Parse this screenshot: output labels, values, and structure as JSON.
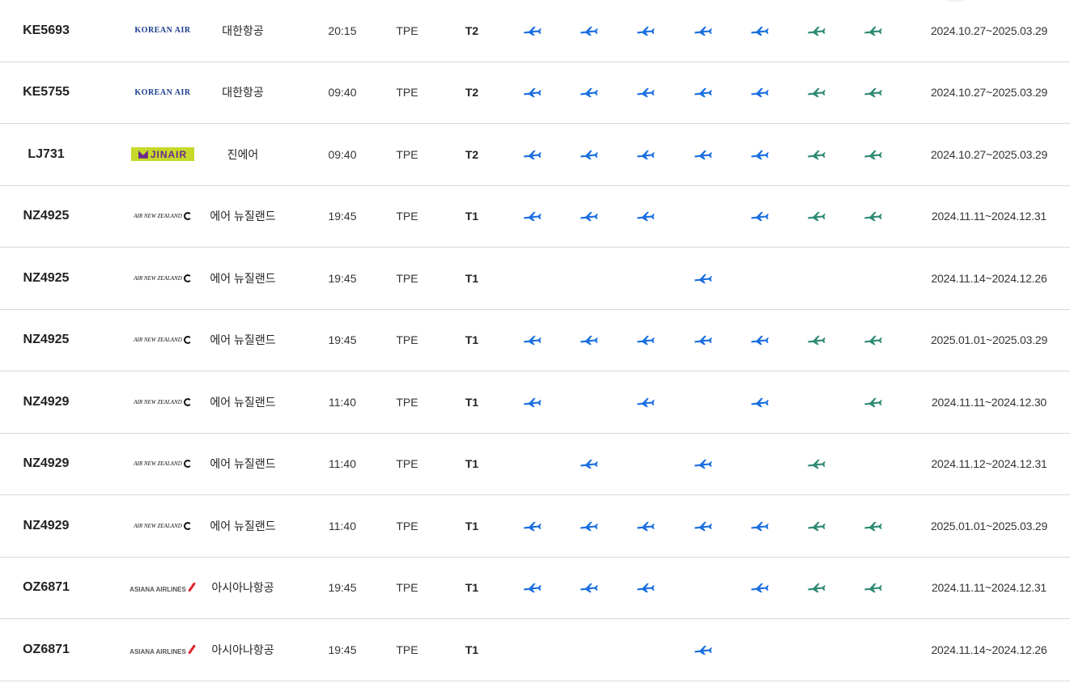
{
  "schedule": {
    "rows": [
      {
        "flight": "KE5693",
        "logo": "korean-air",
        "logo_text": "KOREAN AIR",
        "airline": "대한항공",
        "time": "20:15",
        "dest": "TPE",
        "terminal": "T2",
        "days": [
          "blue",
          "blue",
          "blue",
          "blue",
          "blue",
          "green",
          "green"
        ],
        "period": "2024.10.27~2025.03.29"
      },
      {
        "flight": "KE5755",
        "logo": "korean-air",
        "logo_text": "KOREAN AIR",
        "airline": "대한항공",
        "time": "09:40",
        "dest": "TPE",
        "terminal": "T2",
        "days": [
          "blue",
          "blue",
          "blue",
          "blue",
          "blue",
          "green",
          "green"
        ],
        "period": "2024.10.27~2025.03.29"
      },
      {
        "flight": "LJ731",
        "logo": "jin-air",
        "logo_text": "JINAIR",
        "airline": "진에어",
        "time": "09:40",
        "dest": "TPE",
        "terminal": "T2",
        "days": [
          "blue",
          "blue",
          "blue",
          "blue",
          "blue",
          "green",
          "green"
        ],
        "period": "2024.10.27~2025.03.29"
      },
      {
        "flight": "NZ4925",
        "logo": "air-new-zealand",
        "logo_text": "AIR NEW ZEALAND",
        "airline": "에어 뉴질랜드",
        "time": "19:45",
        "dest": "TPE",
        "terminal": "T1",
        "days": [
          "blue",
          "blue",
          "blue",
          "",
          "blue",
          "green",
          "green"
        ],
        "period": "2024.11.11~2024.12.31"
      },
      {
        "flight": "NZ4925",
        "logo": "air-new-zealand",
        "logo_text": "AIR NEW ZEALAND",
        "airline": "에어 뉴질랜드",
        "time": "19:45",
        "dest": "TPE",
        "terminal": "T1",
        "days": [
          "",
          "",
          "",
          "blue",
          "",
          "",
          ""
        ],
        "period": "2024.11.14~2024.12.26"
      },
      {
        "flight": "NZ4925",
        "logo": "air-new-zealand",
        "logo_text": "AIR NEW ZEALAND",
        "airline": "에어 뉴질랜드",
        "time": "19:45",
        "dest": "TPE",
        "terminal": "T1",
        "days": [
          "blue",
          "blue",
          "blue",
          "blue",
          "blue",
          "green",
          "green"
        ],
        "period": "2025.01.01~2025.03.29"
      },
      {
        "flight": "NZ4929",
        "logo": "air-new-zealand",
        "logo_text": "AIR NEW ZEALAND",
        "airline": "에어 뉴질랜드",
        "time": "11:40",
        "dest": "TPE",
        "terminal": "T1",
        "days": [
          "blue",
          "",
          "blue",
          "",
          "blue",
          "",
          "green"
        ],
        "period": "2024.11.11~2024.12.30"
      },
      {
        "flight": "NZ4929",
        "logo": "air-new-zealand",
        "logo_text": "AIR NEW ZEALAND",
        "airline": "에어 뉴질랜드",
        "time": "11:40",
        "dest": "TPE",
        "terminal": "T1",
        "days": [
          "",
          "blue",
          "",
          "blue",
          "",
          "green",
          ""
        ],
        "period": "2024.11.12~2024.12.31"
      },
      {
        "flight": "NZ4929",
        "logo": "air-new-zealand",
        "logo_text": "AIR NEW ZEALAND",
        "airline": "에어 뉴질랜드",
        "time": "11:40",
        "dest": "TPE",
        "terminal": "T1",
        "days": [
          "blue",
          "blue",
          "blue",
          "blue",
          "blue",
          "green",
          "green"
        ],
        "period": "2025.01.01~2025.03.29"
      },
      {
        "flight": "OZ6871",
        "logo": "asiana",
        "logo_text": "ASIANA AIRLINES",
        "airline": "아시아나항공",
        "time": "19:45",
        "dest": "TPE",
        "terminal": "T1",
        "days": [
          "blue",
          "blue",
          "blue",
          "",
          "blue",
          "green",
          "green"
        ],
        "period": "2024.11.11~2024.12.31"
      },
      {
        "flight": "OZ6871",
        "logo": "asiana",
        "logo_text": "ASIANA AIRLINES",
        "airline": "아시아나항공",
        "time": "19:45",
        "dest": "TPE",
        "terminal": "T1",
        "days": [
          "",
          "",
          "",
          "blue",
          "",
          "",
          ""
        ],
        "period": "2024.11.14~2024.12.26"
      }
    ]
  },
  "icons": {
    "operating_day": "airplane-icon"
  },
  "colors": {
    "weekday_plane": "#1a6fe0",
    "weekend_plane": "#2e8a73",
    "divider": "#d9d9d9"
  }
}
